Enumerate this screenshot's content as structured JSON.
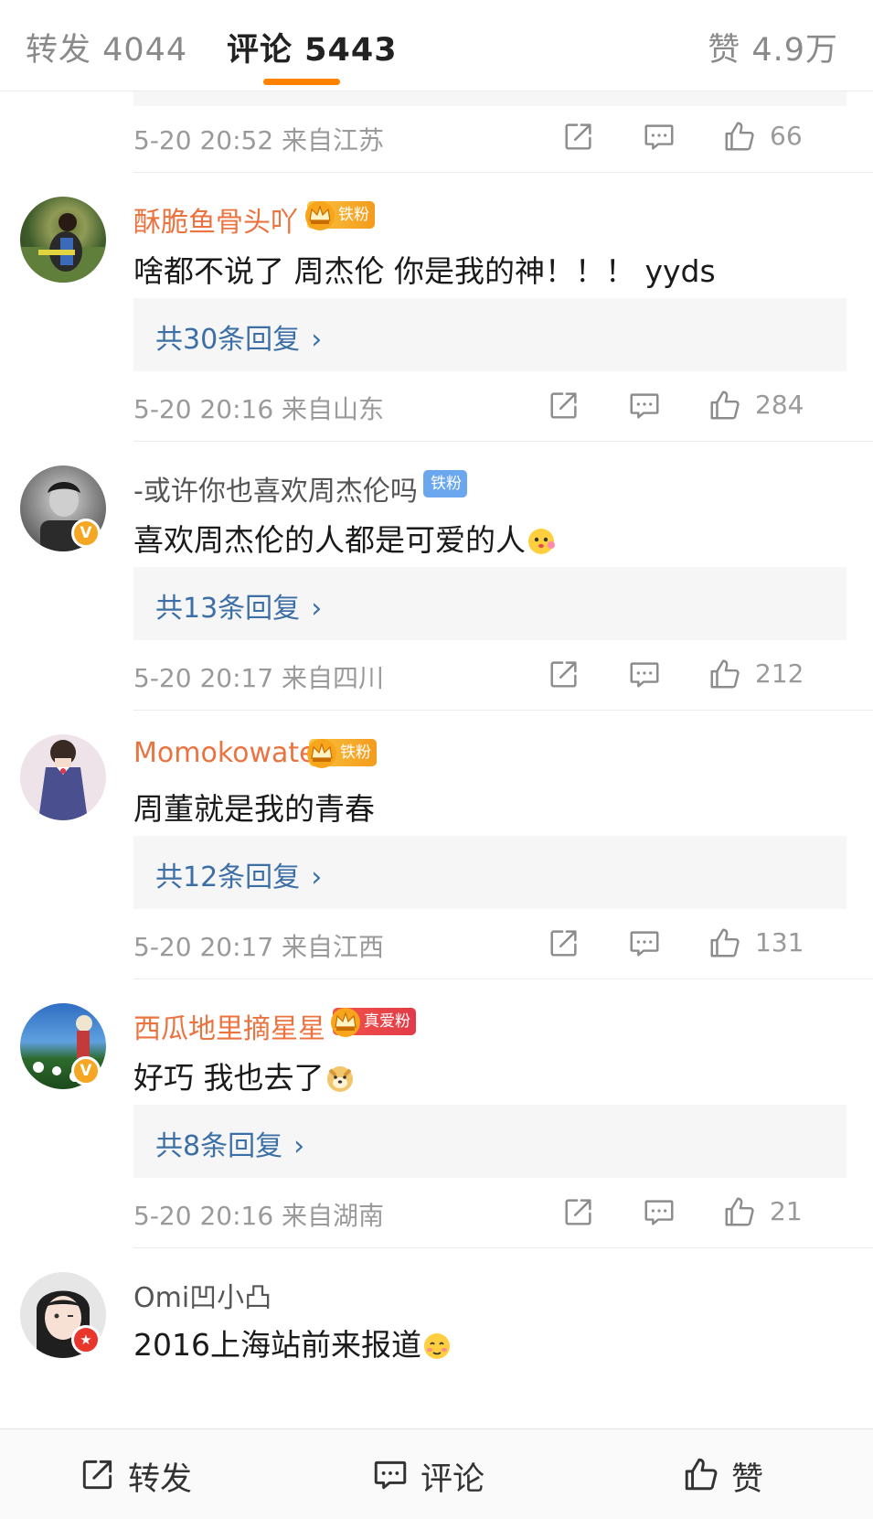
{
  "tabs": {
    "repost": "转发 4044",
    "comments": "评论 5443",
    "likes": "赞 4.9万"
  },
  "colors": {
    "accent": "#ff8200",
    "name_orange": "#eb7340",
    "link_blue": "#3c6fa6",
    "meta_gray": "#9a9a9a"
  },
  "partial_comment": {
    "meta": "5-20 20:52 来自江苏",
    "likes": "66"
  },
  "comments": [
    {
      "user": "酥脆鱼骨头吖",
      "badge": "铁粉",
      "badge_style": "gold",
      "text": "啥都不说了  周杰伦 你是我的神！！！  yyds",
      "replies": "共30条回复",
      "meta": "5-20 20:16 来自山东",
      "likes": "284"
    },
    {
      "user": "-或许你也喜欢周杰伦吗",
      "badge": "铁粉",
      "badge_style": "blue",
      "text": "喜欢周杰伦的人都是可爱的人",
      "emoji": "cute-face-emoji",
      "replies": "共13条回复",
      "meta": "5-20 20:17 来自四川",
      "likes": "212"
    },
    {
      "user": "Momokowate",
      "badge": "铁粉",
      "badge_style": "gold",
      "text": "周董就是我的青春",
      "replies": "共12条回复",
      "meta": "5-20 20:17 来自江西",
      "likes": "131"
    },
    {
      "user": "西瓜地里摘星星",
      "badge": "真爱粉",
      "badge_style": "red",
      "text": "好巧 我也去了",
      "emoji": "doge-emoji",
      "replies": "共8条回复",
      "meta": "5-20 20:16 来自湖南",
      "likes": "21"
    },
    {
      "user": "Omi凹小凸",
      "text": "2016上海站前来报道",
      "emoji": "shy-face-emoji"
    }
  ],
  "bottom_bar": {
    "repost": "转发",
    "comment": "评论",
    "like": "赞"
  },
  "icons": {
    "share": "share-icon",
    "reply": "comment-icon",
    "like": "thumbs-up-icon",
    "chevron": "chevron-right-icon",
    "verified": "verified-v-icon",
    "crown": "crown-icon"
  }
}
